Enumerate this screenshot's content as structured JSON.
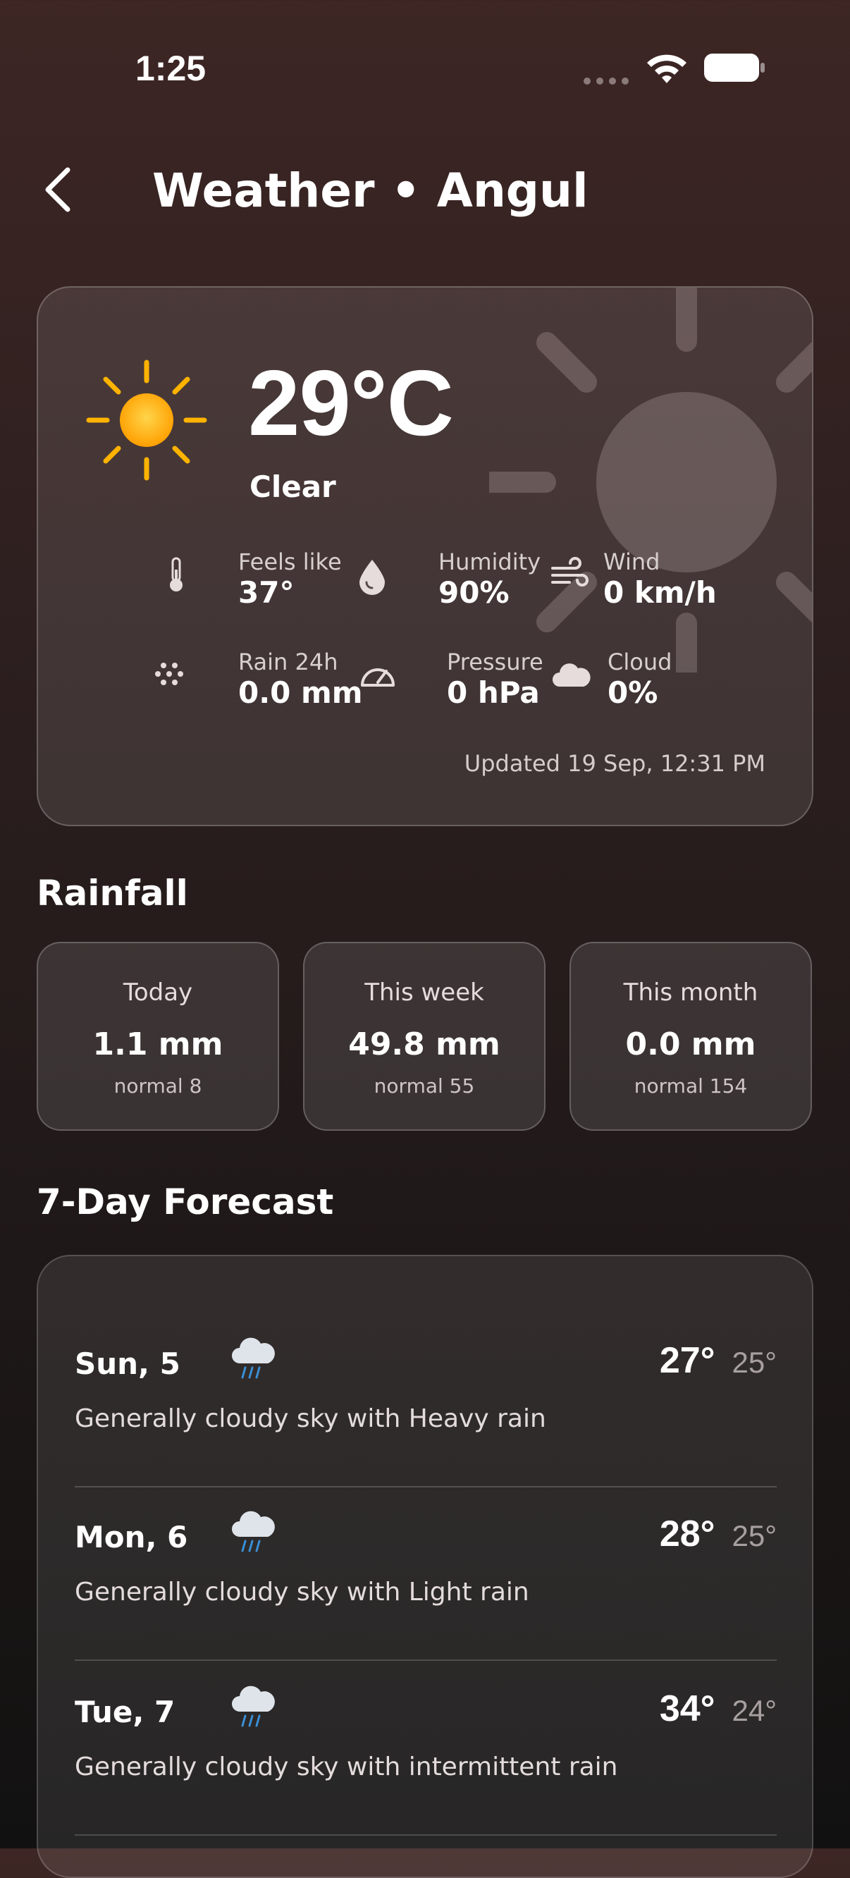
{
  "status_bar": {
    "time": "1:25"
  },
  "header": {
    "title": "Weather • Angul"
  },
  "current": {
    "temperature": "29°C",
    "condition": "Clear",
    "metrics": [
      {
        "label": "Feels like",
        "value": "37°",
        "icon": "thermometer-icon"
      },
      {
        "label": "Humidity",
        "value": "90%",
        "icon": "droplet-icon"
      },
      {
        "label": "Wind",
        "value": "0 km/h",
        "icon": "wind-icon"
      },
      {
        "label": "Rain 24h",
        "value": "0.0 mm",
        "icon": "rain-dots-icon"
      },
      {
        "label": "Pressure",
        "value": "0 hPa",
        "icon": "gauge-icon"
      },
      {
        "label": "Cloud",
        "value": "0%",
        "icon": "cloud-icon"
      }
    ],
    "updated": "Updated 19 Sep, 12:31 PM"
  },
  "rainfall": {
    "title": "Rainfall",
    "boxes": [
      {
        "label": "Today",
        "value": "1.1 mm",
        "normal": "normal 8"
      },
      {
        "label": "This week",
        "value": "49.8 mm",
        "normal": "normal 55"
      },
      {
        "label": "This month",
        "value": "0.0 mm",
        "normal": "normal 154"
      }
    ]
  },
  "forecast": {
    "title": "7-Day Forecast",
    "days": [
      {
        "day": "Sun, 5",
        "high": "27°",
        "low": "25°",
        "desc": "Generally cloudy sky with Heavy rain"
      },
      {
        "day": "Mon, 6",
        "high": "28°",
        "low": "25°",
        "desc": "Generally cloudy sky with Light rain"
      },
      {
        "day": "Tue, 7",
        "high": "34°",
        "low": "24°",
        "desc": "Generally cloudy sky with intermittent rain"
      }
    ]
  },
  "colors": {
    "sun": "#ffb300",
    "accent_bg": "#3d2624"
  }
}
